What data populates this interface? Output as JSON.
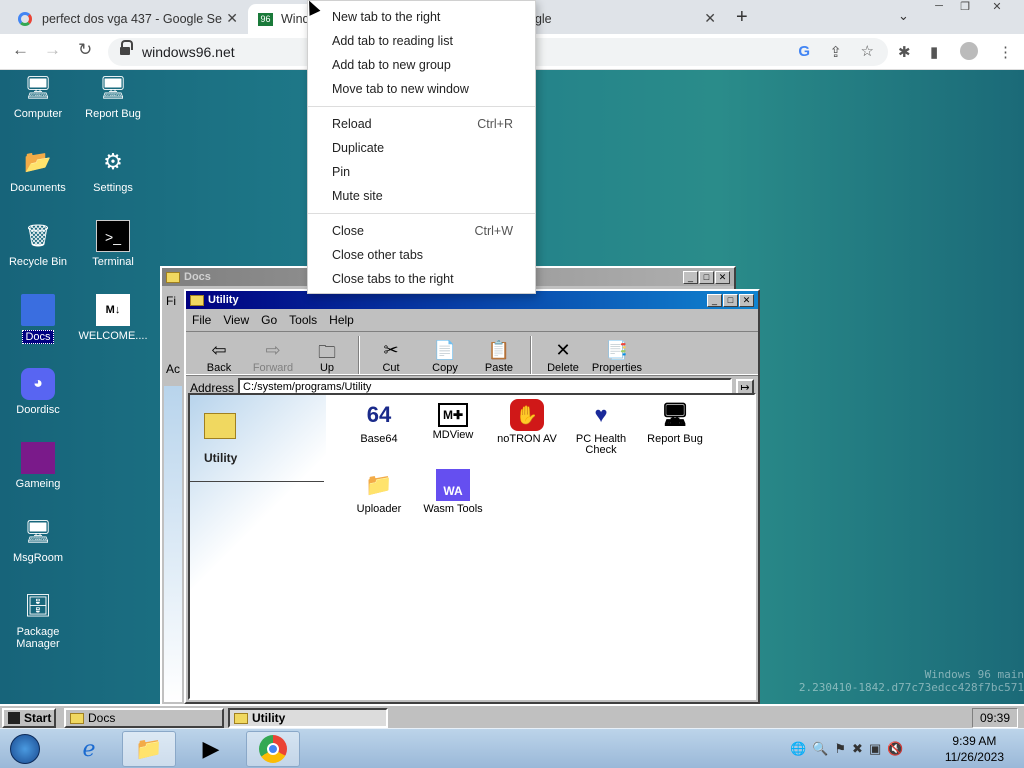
{
  "browser": {
    "tabs": [
      {
        "title": "perfect dos vga 437 - Google Se"
      },
      {
        "title": "Wind"
      },
      {
        "title": "ogle"
      }
    ],
    "url": "windows96.net"
  },
  "context_menu": {
    "groups": [
      [
        {
          "label": "New tab to the right"
        },
        {
          "label": "Add tab to reading list"
        },
        {
          "label": "Add tab to new group"
        },
        {
          "label": "Move tab to new window"
        }
      ],
      [
        {
          "label": "Reload",
          "shortcut": "Ctrl+R"
        },
        {
          "label": "Duplicate"
        },
        {
          "label": "Pin"
        },
        {
          "label": "Mute site"
        }
      ],
      [
        {
          "label": "Close",
          "shortcut": "Ctrl+W"
        },
        {
          "label": "Close other tabs"
        },
        {
          "label": "Close tabs to the right"
        }
      ]
    ]
  },
  "desktop_icons": [
    {
      "label": "Computer",
      "icon": "computer-icon"
    },
    {
      "label": "Report Bug",
      "icon": "report-bug-icon"
    },
    {
      "label": "Documents",
      "icon": "documents-icon"
    },
    {
      "label": "Settings",
      "icon": "settings-icon"
    },
    {
      "label": "Recycle Bin",
      "icon": "recycle-bin-icon"
    },
    {
      "label": "Terminal",
      "icon": "terminal-icon"
    },
    {
      "label": "Docs",
      "icon": "folder-icon"
    },
    {
      "label": "WELCOME....",
      "icon": "markdown-file-icon"
    },
    {
      "label": "Doordisc",
      "icon": "discord-icon"
    },
    {
      "label": "Gameing",
      "icon": "game-cube-icon"
    },
    {
      "label": "MsgRoom",
      "icon": "msgroom-icon"
    },
    {
      "label": "Package Manager",
      "icon": "package-manager-icon"
    }
  ],
  "watermark": {
    "line1": "Windows 96 main",
    "line2": "2.230410-1842.d77c73edcc428f7bc571"
  },
  "docs_window": {
    "title": "Docs",
    "peek_menu": "Fi",
    "peek_address": "Ac"
  },
  "utility_window": {
    "title": "Utility",
    "menu": [
      "File",
      "View",
      "Go",
      "Tools",
      "Help"
    ],
    "toolbar": [
      "Back",
      "Forward",
      "Up",
      "Cut",
      "Copy",
      "Paste",
      "Delete",
      "Properties"
    ],
    "address_label": "Address",
    "address": "C:/system/programs/Utility",
    "pane_title": "Utility",
    "files": [
      {
        "label": "Base64",
        "icon": "base64-icon"
      },
      {
        "label": "MDView",
        "icon": "mdview-icon"
      },
      {
        "label": "noTRON AV",
        "icon": "stop-hand-icon"
      },
      {
        "label": "PC Health Check",
        "icon": "heart-pulse-icon"
      },
      {
        "label": "Report Bug",
        "icon": "report-bug-icon"
      },
      {
        "label": "Uploader",
        "icon": "uploader-icon"
      },
      {
        "label": "Wasm Tools",
        "icon": "wasm-icon"
      }
    ]
  },
  "taskbar95": {
    "start": "Start",
    "tasks": [
      "Docs",
      "Utility"
    ],
    "clock": "09:39"
  },
  "windows_taskbar": {
    "time": "9:39 AM",
    "date": "11/26/2023"
  }
}
